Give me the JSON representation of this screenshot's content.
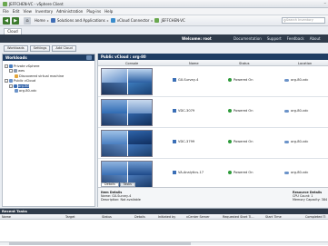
{
  "window": {
    "title": "JEFFCHEN-VC - vSphere Client"
  },
  "menu": [
    "File",
    "Edit",
    "View",
    "Inventory",
    "Administration",
    "Plug-ins",
    "Help"
  ],
  "breadcrumb": {
    "home": "Home",
    "item1": "Solutions and Applications",
    "item2": "vCloud Connector",
    "item3": "JEFFCHEN-VC"
  },
  "search": {
    "placeholder": "Search Inventory"
  },
  "tabs": {
    "cloud": "Cloud"
  },
  "vbar": {
    "welcome": "Welcome: root",
    "links": [
      "Documentation",
      "Support",
      "Feedback",
      "About"
    ]
  },
  "workspace_buttons": [
    "Workloads",
    "Settings",
    "Add Cloud"
  ],
  "left_panel": {
    "title": "Workloads",
    "tree": [
      {
        "label": "Private vSphere",
        "level": 0,
        "toggle": "-"
      },
      {
        "label": "wes",
        "level": 1,
        "toggle": "-"
      },
      {
        "label": "Discovered virtual machine",
        "level": 2,
        "toggle": ""
      },
      {
        "label": "Public vCloud",
        "level": 0,
        "toggle": "-"
      },
      {
        "label": "org-80",
        "level": 1,
        "toggle": "-",
        "selected": true
      },
      {
        "label": "org-80-vdc",
        "level": 2,
        "toggle": ""
      }
    ]
  },
  "main_panel": {
    "title": "Public vCloud : org-80",
    "columns": [
      "Console",
      "Name",
      "Status",
      "Location"
    ],
    "rows": [
      {
        "name": "GX-Survey-4",
        "status": "Powered On",
        "location": "org-80-vdc"
      },
      {
        "name": "VDC-3079",
        "status": "Powered On",
        "location": "org-80-vdc"
      },
      {
        "name": "VDC-3799",
        "status": "Powered On",
        "location": "org-80-vdc"
      },
      {
        "name": "VA-Analytics-17",
        "status": "Powered On",
        "location": "org-80-vdc"
      }
    ]
  },
  "details": {
    "tabs": [
      "Details",
      "Tasks"
    ],
    "item_title": "Item Details",
    "name_line": "Name: GX-Survey-4",
    "desc_line": "Description: Not available",
    "res_title": "Resource Details",
    "cpu_line": "CPU Count: 1",
    "mem_line": "Memory Capacity: 384"
  },
  "recent": {
    "title": "Recent Tasks",
    "columns": [
      "Name",
      "Target",
      "Status",
      "Details",
      "Initiated by",
      "vCenter Server",
      "Requested Start Ti...",
      "Start Time",
      "Completed Ti"
    ]
  }
}
